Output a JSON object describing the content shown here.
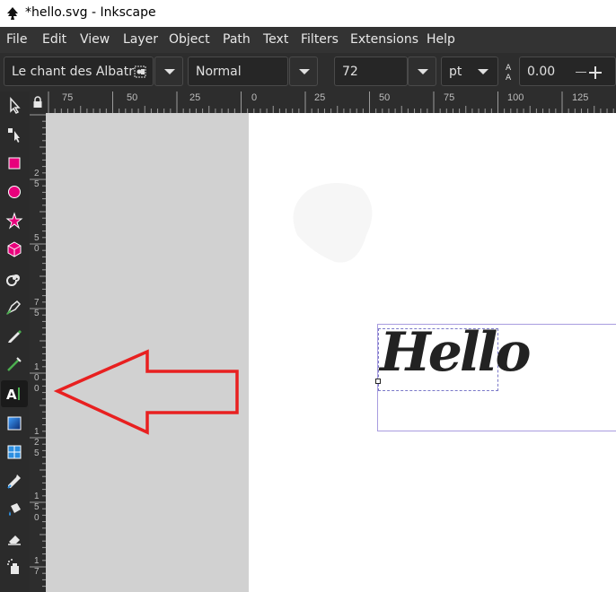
{
  "window": {
    "title": "*hello.svg - Inkscape",
    "icon": "inkscape-logo-icon"
  },
  "menu": [
    {
      "label": "File"
    },
    {
      "label": "Edit"
    },
    {
      "label": "View"
    },
    {
      "label": "Layer"
    },
    {
      "label": "Object"
    },
    {
      "label": "Path"
    },
    {
      "label": "Text"
    },
    {
      "label": "Filters"
    },
    {
      "label": "Extensions"
    },
    {
      "label": "Help"
    }
  ],
  "text_toolbar": {
    "font_family": "Le chant des Albatr",
    "font_style": "Normal",
    "font_size": "72",
    "unit": "pt",
    "spacing_value": "0.00"
  },
  "ruler_top": {
    "labels": [
      "75",
      "50",
      "25",
      "0",
      "25",
      "50",
      "75",
      "100",
      "125"
    ]
  },
  "ruler_left": {
    "labels": [
      "2",
      "5",
      "5",
      "0",
      "7",
      "5",
      "1",
      "0",
      "0",
      "1",
      "2",
      "5",
      "1",
      "5",
      "0",
      "1",
      "7"
    ]
  },
  "tools": [
    {
      "name": "selector-tool",
      "icon": "arrow-icon"
    },
    {
      "name": "node-tool",
      "icon": "node-icon"
    },
    {
      "name": "rectangle-tool",
      "icon": "square-icon"
    },
    {
      "name": "ellipse-tool",
      "icon": "circle-icon"
    },
    {
      "name": "star-tool",
      "icon": "star-icon"
    },
    {
      "name": "3d-box-tool",
      "icon": "cube-icon"
    },
    {
      "name": "spiral-tool",
      "icon": "spiral-icon"
    },
    {
      "name": "pen-tool",
      "icon": "pen-icon"
    },
    {
      "name": "pencil-tool",
      "icon": "pencil-icon"
    },
    {
      "name": "calligraphy-tool",
      "icon": "calligraphy-icon"
    },
    {
      "name": "text-tool",
      "icon": "text-icon",
      "active": true
    },
    {
      "name": "gradient-tool",
      "icon": "gradient-icon"
    },
    {
      "name": "mesh-tool",
      "icon": "mesh-icon"
    },
    {
      "name": "dropper-tool",
      "icon": "dropper-icon"
    },
    {
      "name": "paint-bucket-tool",
      "icon": "bucket-icon"
    },
    {
      "name": "eraser-tool",
      "icon": "eraser-icon"
    },
    {
      "name": "spray-tool",
      "icon": "spray-icon"
    }
  ],
  "canvas": {
    "text_content": "Hello"
  },
  "colors": {
    "arrow_annotation": "#e82020",
    "selection": "#a89cdf",
    "text": "#222222"
  }
}
